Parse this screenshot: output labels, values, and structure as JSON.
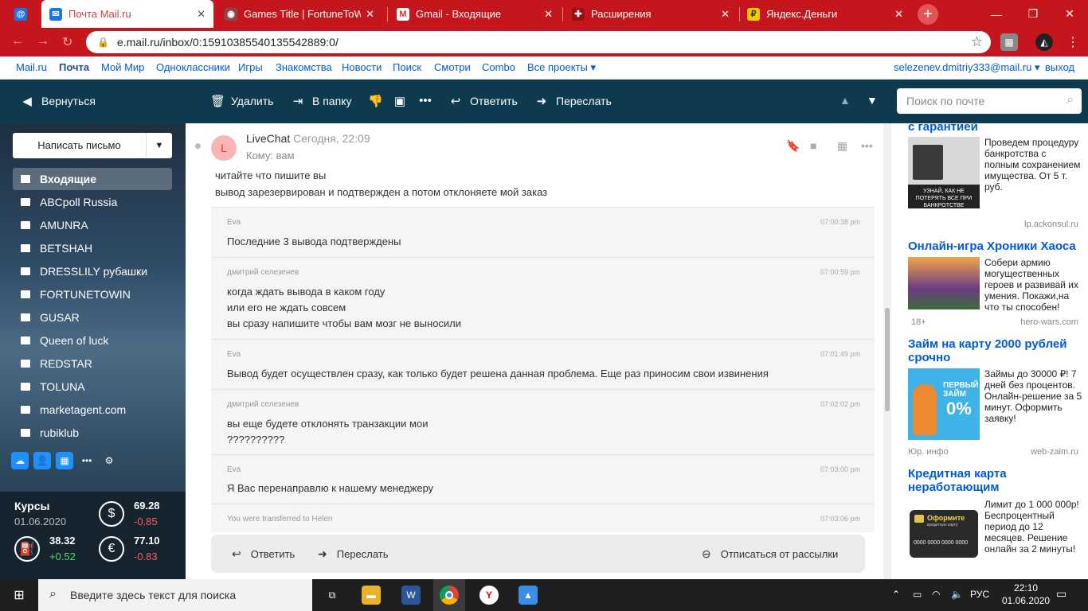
{
  "browser": {
    "tabs": [
      {
        "title": "Почта Mail.ru",
        "icon": "mail-icon",
        "active": true
      },
      {
        "title": "Games Title | FortuneToWin",
        "icon": "globe-icon"
      },
      {
        "title": "Gmail - Входящие",
        "icon": "gmail-icon"
      },
      {
        "title": "Расширения",
        "icon": "puzzle-icon"
      },
      {
        "title": "Яндекс.Деньги",
        "icon": "yandex-money-icon"
      }
    ],
    "url": "e.mail.ru/inbox/0:15910385540135542889:0/"
  },
  "portal_nav": {
    "links": [
      "Mail.ru",
      "Почта",
      "Мой Мир",
      "Одноклассники",
      "Игры",
      "Знакомства",
      "Новости",
      "Поиск",
      "Смотри",
      "Combo",
      "Все проекты ▾"
    ],
    "user": "selezenev.dmitriy333@mail.ru ▾",
    "logout": "выход"
  },
  "toolbar": {
    "back": "Вернуться",
    "delete": "Удалить",
    "to_folder": "В папку",
    "reply": "Ответить",
    "forward": "Переслать",
    "search_placeholder": "Поиск по почте"
  },
  "sidebar": {
    "compose": "Написать письмо",
    "folders": [
      "Входящие",
      "ABCpoll Russia",
      "AMUNRA",
      "BETSHAH",
      "DRESSLILY рубашки",
      "FORTUNETOWIN",
      "GUSAR",
      "Queen of luck",
      "REDSTAR",
      "TOLUNA",
      "marketagent.com",
      "rubiklub"
    ],
    "rates": {
      "label": "Курсы",
      "date": "01.06.2020",
      "usd": "69.28",
      "usd_change": "-0.85",
      "oil": "38.32",
      "oil_change": "+0.52",
      "eur": "77.10",
      "eur_change": "-0.83"
    }
  },
  "message": {
    "avatar_letter": "L",
    "sender": "LiveChat",
    "date": "Сегодня, 22:09",
    "to": "Кому: вам",
    "intro": [
      "читайте что пишите вы",
      "вывод зарезервирован и подтвержден а потом отклоняете мой заказ"
    ],
    "chat": [
      {
        "author": "Eva",
        "time": "07:00:38 pm",
        "lines": [
          "Последние 3 вывода подтверждены"
        ]
      },
      {
        "author": "дмитрий селезенев",
        "time": "07:00:59 pm",
        "lines": [
          "когда ждать вывода в каком году",
          "или его не ждать совсем",
          "вы сразу напишите чтобы вам мозг не выносили"
        ]
      },
      {
        "author": "Eva",
        "time": "07:01:49 pm",
        "lines": [
          "Вывод будет осуществлен сразу, как только будет решена данная проблема. Еще раз приносим свои извинения"
        ]
      },
      {
        "author": "дмитрий селезенев",
        "time": "07:02:02 pm",
        "lines": [
          "вы еще будете отклонять транзакции мои",
          "??????????"
        ]
      },
      {
        "author": "Eva",
        "time": "07:03:00 pm",
        "lines": [
          "Я Вас перенаправлю к нашему менеджеру"
        ]
      },
      {
        "author": "You were transferred to Helen",
        "time": "07:03:06 pm",
        "lines": []
      }
    ],
    "actions": {
      "reply": "Ответить",
      "forward": "Переслать",
      "unsubscribe": "Отписаться от рассылки"
    }
  },
  "ads": [
    {
      "title": "с гарантией",
      "text": "Проведем процедуру банкротства с полным сохранением имущества. От 5 т. руб.",
      "domain": "lp.ackonsul.ru",
      "age": ""
    },
    {
      "title": "Онлайн-игра Хроники Хаоса",
      "text": "Собери армию могущественных героев и развивай их умения. Покажи,на что ты способен!",
      "domain": "hero-wars.com",
      "age": "18+"
    },
    {
      "title": "Займ на карту 2000 рублей срочно",
      "text": "Займы до 30000 ₽! 7 дней без процентов. Онлайн-решение за 5 минут. Оформить заявку!",
      "domain": "web-zaim.ru",
      "age": "Юр. инфо"
    },
    {
      "title": "Кредитная карта неработающим",
      "text": "Лимит до 1 000 000р! Беспроцентный период до 12 месяцев. Решение онлайн за 2 минуты!",
      "domain": "",
      "age": ""
    }
  ],
  "ad_image_text": {
    "bankrupt": "УЗНАЙ, КАК НЕ ПОТЕРЯТЬ ВСЕ ПРИ БАНКРОТСТВЕ",
    "zaim": "ПЕРВЫЙ ЗАЙМ",
    "zaim_pct": "0%",
    "card": "Оформите",
    "card_sub": "кредитную карту",
    "card_num": "0000 0000 0000 0000"
  },
  "taskbar": {
    "search": "Введите здесь текст для поиска",
    "lang": "РУС",
    "time": "22:10",
    "date": "01.06.2020"
  }
}
